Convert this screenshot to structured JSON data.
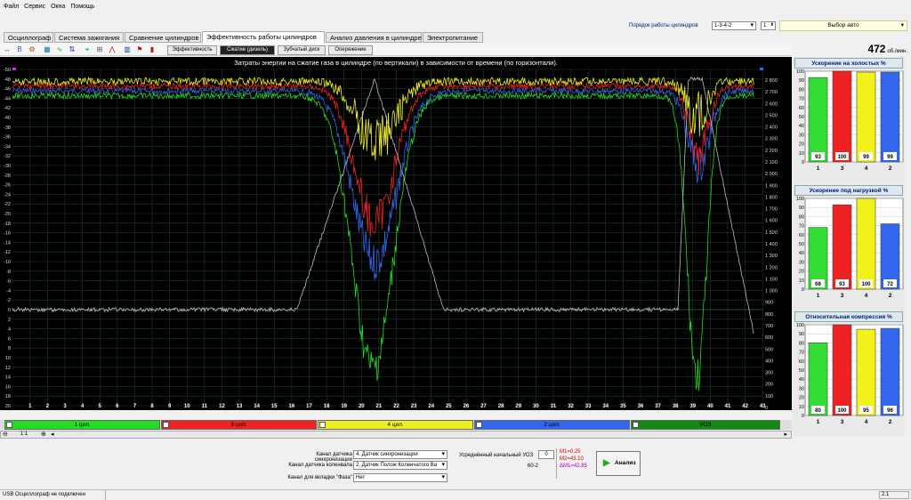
{
  "menu": [
    "Файл",
    "Сервис",
    "Окна",
    "Помощь"
  ],
  "order": {
    "label": "Порядок работы цилиндров",
    "value": "1-3-4-2",
    "stepper": "1",
    "vehicle": "Выбор авто"
  },
  "tabs": [
    "Осциллограф",
    "Система зажигания",
    "Сравнение цилиндров",
    "Эффективность работы цилиндров",
    "Анализ давления в цилиндре",
    "Электропитание"
  ],
  "active_tab": 3,
  "subtabs": [
    "Эффективность",
    "Сжатие (дизель)",
    "Зубчатый диск",
    "Опережение"
  ],
  "active_subtab": 1,
  "rpm": {
    "value": "472",
    "unit": "об./мин."
  },
  "plot": {
    "title": "Затраты энергии на сжатие газа в цилиндре (по вертикали) в зависимости от времени (по горизонтали).",
    "left_ticks": [
      "-50",
      "-48",
      "-46",
      "-44",
      "-42",
      "-40",
      "-38",
      "-36",
      "-34",
      "-32",
      "-30",
      "-28",
      "-26",
      "-24",
      "-22",
      "-20",
      "-18",
      "-16",
      "-14",
      "-12",
      "-10",
      "-8",
      "-6",
      "-4",
      "-2",
      "0",
      "2",
      "4",
      "6",
      "8",
      "10",
      "12",
      "14",
      "16",
      "18",
      "20"
    ],
    "right_ticks": [
      "2 800",
      "2 700",
      "2 600",
      "2 500",
      "2 400",
      "2 300",
      "2 200",
      "2 100",
      "2 000",
      "1 900",
      "1 800",
      "1 700",
      "1 600",
      "1 500",
      "1 400",
      "1 300",
      "1 200",
      "1 100",
      "1 000",
      "900",
      "800",
      "700",
      "600",
      "500",
      "400",
      "300",
      "200",
      "100",
      "0"
    ],
    "x_ticks": [
      "1",
      "2",
      "3",
      "4",
      "5",
      "6",
      "7",
      "8",
      "9",
      "10",
      "11",
      "12",
      "13",
      "14",
      "15",
      "16",
      "17",
      "18",
      "19",
      "20",
      "21",
      "22",
      "23",
      "24",
      "25",
      "26",
      "27",
      "28",
      "29",
      "30",
      "31",
      "32",
      "33",
      "34",
      "35",
      "36",
      "37",
      "38",
      "39",
      "40",
      "41",
      "42",
      "43"
    ]
  },
  "lanes": [
    {
      "label": "1 цил.",
      "color": "#22dd22"
    },
    {
      "label": "3 цил.",
      "color": "#ee2222"
    },
    {
      "label": "4 цил.",
      "color": "#eeee22"
    },
    {
      "label": "2 цил.",
      "color": "#3366ee"
    },
    {
      "label": "УОЗ",
      "color": "#118811"
    }
  ],
  "zoom": "1:1",
  "controls": {
    "sync_label": "Канал датчика синхронизации",
    "sync_value": "4. Датчик синхронизации",
    "crank_label": "Канал датчика коленвала",
    "crank_value": "2. Датчик Полож Коленчатого Ва",
    "phase_label": "Канал для вкладки \"Фаза\"",
    "phase_value": "Нет",
    "uoz_label": "Усреднённый начальный УОЗ",
    "uoz_value": "0",
    "tooth": "60-2",
    "m1": "M1=0.25",
    "m2": "M2=43.10",
    "dm": "ΔM1=42.85",
    "analyze": "Анализ"
  },
  "status": {
    "left": "USB Осциллограф не подключен",
    "right": "2.1"
  },
  "bar_panels": [
    {
      "title": "Ускорение на холостых %",
      "cylinders": [
        "1",
        "3",
        "4",
        "2"
      ],
      "values": [
        93,
        100,
        99,
        99
      ]
    },
    {
      "title": "Ускорение под нагрузкой %",
      "cylinders": [
        "1",
        "3",
        "4",
        "2"
      ],
      "values": [
        68,
        93,
        100,
        72
      ]
    },
    {
      "title": "Относительная компрессия %",
      "cylinders": [
        "1",
        "3",
        "4",
        "2"
      ],
      "values": [
        80,
        100,
        95,
        96
      ]
    }
  ],
  "bar_ticks": [
    "100",
    "90",
    "80",
    "70",
    "60",
    "50",
    "40",
    "30",
    "20",
    "10",
    "0"
  ],
  "bar_colors": [
    "#33dd33",
    "#ee2222",
    "#f2f21a",
    "#3366ee"
  ]
}
